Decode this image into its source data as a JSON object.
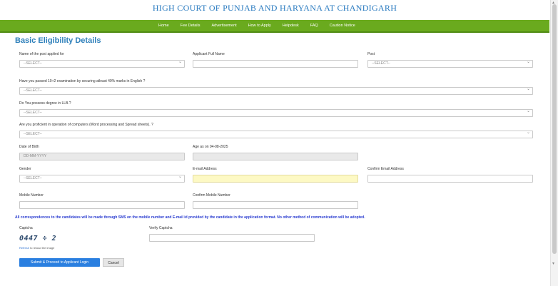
{
  "header": {
    "title": "HIGH COURT OF PUNJAB AND HARYANA AT CHANDIGARH"
  },
  "nav": {
    "items": [
      "Home",
      "Fee Details",
      "Advertisement",
      "How to Apply",
      "Helpdesk",
      "FAQ",
      "Caution Notice"
    ]
  },
  "form": {
    "title": "Basic Eligibility Details",
    "post_applied_label": "Name of the post applied for",
    "post_applied_value": "--SELECT--",
    "full_name_label": "Applicant Full Name",
    "post_label": "Post",
    "post_value": "--SELECT--",
    "q1_label": "Have you passed 10+2 examination by securing atleast 40% marks in English ?",
    "q1_value": "--SELECT--",
    "q2_label": "Do You possess degree in LLB.?",
    "q2_value": "--SELECT--",
    "q3_label": "Are you proficient in operation of computers (Word processing and Spread sheets). ?",
    "q3_value": "--SELECT--",
    "dob_label": "Date of Birth",
    "dob_placeholder": "DD-MM-YYYY",
    "age_label": "Age as on 04-08-2025",
    "gender_label": "Gender",
    "gender_value": "--SELECT--",
    "email_label": "E-mail Address",
    "confirm_email_label": "Confirm Email Address",
    "mobile_label": "Mobile Number",
    "confirm_mobile_label": "Confirm Mobile Number",
    "notice": "All correspondences to the candidates will be made through SMS on the mobile number and E-mail id provided by the candidate in the application format. No other method of communication will be adopted.",
    "captcha_label": "Captcha",
    "captcha_text": "0447 ÷ 2",
    "refresh_link": "Refresh",
    "refresh_text": " to reload the image",
    "verify_label": "Verify Captcha",
    "submit_label": "Submit & Proceed to Applicant Login",
    "cancel_label": "Cancel"
  },
  "colors": {
    "nav_bg": "#6aaa1e",
    "title": "#2d7fba",
    "notice": "#2a3cd0",
    "submit": "#2a7fe0"
  }
}
